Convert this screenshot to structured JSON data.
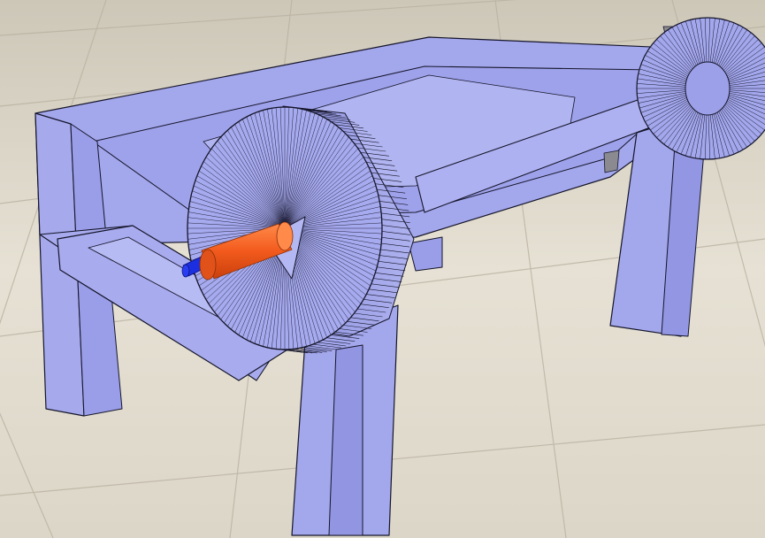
{
  "scene": {
    "floor_colors": [
      "#e8e3d6",
      "#d8d2c3",
      "#cfc8b8"
    ],
    "mesh_fill": "#a3a7ec",
    "mesh_fill_dark": "#8d92de",
    "mesh_fill_light": "#b6baf2",
    "mesh_stroke": "#15152a",
    "gray_accent": "#8a8a90",
    "cylinder_orange": "#f25a1c",
    "cylinder_orange_light": "#ff7a3a",
    "shaft_blue": "#1c2fe0"
  }
}
